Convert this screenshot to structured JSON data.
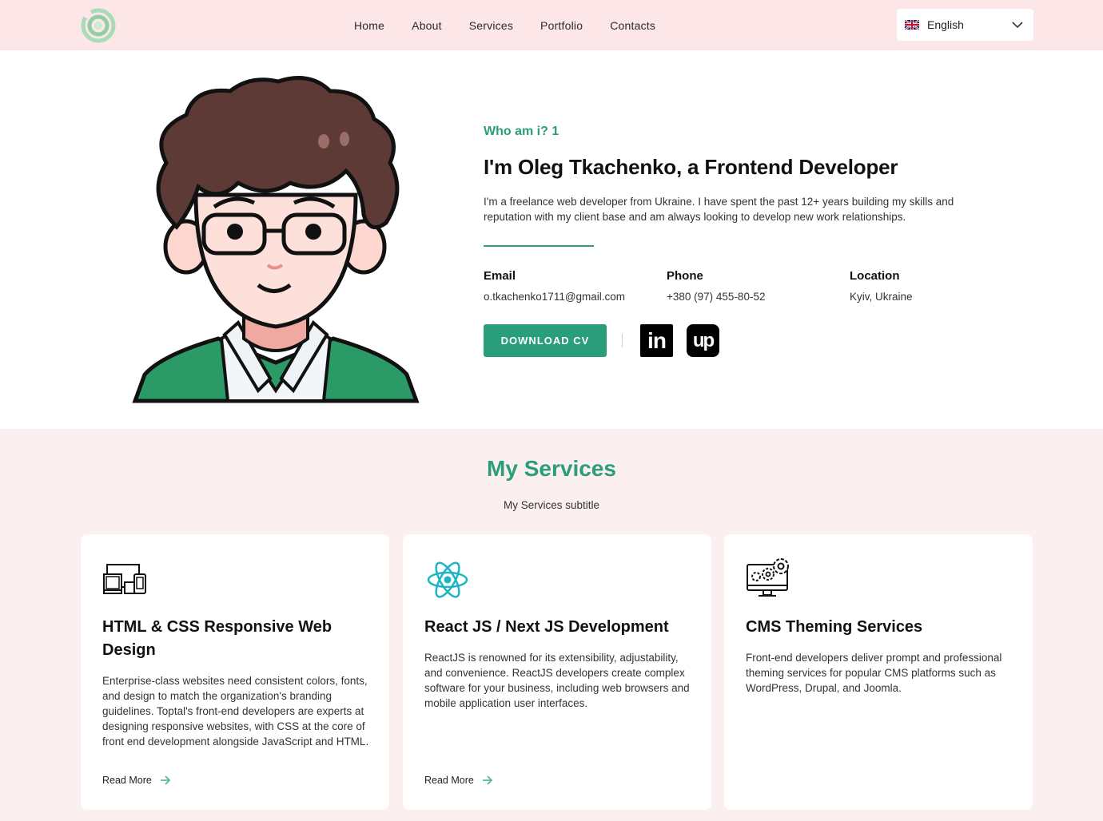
{
  "nav": {
    "items": [
      {
        "label": "Home"
      },
      {
        "label": "About"
      },
      {
        "label": "Services"
      },
      {
        "label": "Portfolio"
      },
      {
        "label": "Contacts"
      }
    ],
    "language": "English"
  },
  "hero": {
    "eyebrow": "Who am i? 1",
    "title": "I'm Oleg Tkachenko, a Frontend Developer",
    "description": "I'm a freelance web developer from Ukraine. I have spent the past 12+ years building my skills and reputation with my client base and am always looking to develop new work relationships.",
    "info": [
      {
        "label": "Email",
        "value": "o.tkachenko1711@gmail.com"
      },
      {
        "label": "Phone",
        "value": "+380 (97) 455-80-52"
      },
      {
        "label": "Location",
        "value": "Kyiv, Ukraine"
      }
    ],
    "cv_button": "DOWNLOAD CV",
    "social": [
      {
        "icon": "linkedin-icon",
        "glyph": "in"
      },
      {
        "icon": "upwork-icon",
        "glyph": "up"
      }
    ]
  },
  "services": {
    "title": "My Services",
    "subtitle": "My Services subtitle",
    "cards": [
      {
        "icon": "devices-icon",
        "title": "HTML & CSS Responsive Web Design",
        "text": "Enterprise-class websites need consistent colors, fonts, and design to match the organization's branding guidelines. Toptal's front-end developers are experts at designing responsive websites, with CSS at the core of front end development alongside JavaScript and HTML.",
        "more": "Read More"
      },
      {
        "icon": "react-icon",
        "title": "React JS / Next JS Development",
        "text": "ReactJS is renowned for its extensibility, adjustability, and convenience. ReactJS developers create complex software for your business, including web browsers and mobile application user interfaces.",
        "more": "Read More"
      },
      {
        "icon": "cms-gear-monitor-icon",
        "title": "CMS Theming Services",
        "text": "Front-end developers deliver prompt and professional theming services for popular CMS platforms such as WordPress, Drupal, and Joomla.",
        "more": ""
      }
    ]
  },
  "colors": {
    "accent": "#2a9d7a",
    "header_bg": "#fde6e8",
    "services_bg": "#fcefef"
  }
}
